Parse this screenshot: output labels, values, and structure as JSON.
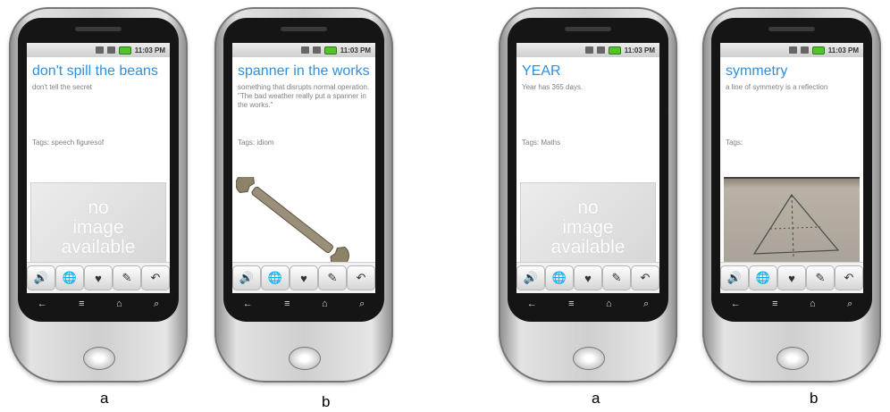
{
  "status_time": "11:03 PM",
  "phones": [
    {
      "title": "don't spill the beans",
      "description": "don't tell the secret",
      "tags": "Tags: speech figuresof",
      "image": "no-image",
      "noimage_text": [
        "no",
        "image",
        "available"
      ]
    },
    {
      "title": "spanner in the works",
      "description": "something that disrupts normal operation. \"The bad weather really put a spanner in the works.\"",
      "tags": "Tags: idiom",
      "image": "wrench-photo"
    },
    {
      "title": "YEAR",
      "description": "Year has 365 days.",
      "tags": "Tags: Maths",
      "image": "no-image",
      "noimage_text": [
        "no",
        "image",
        "available"
      ]
    },
    {
      "title": "symmetry",
      "description": "a line of symmetry is a reflection",
      "tags": "Tags:",
      "image": "triangle-sketch-photo"
    }
  ],
  "toolbar_icons": [
    "speaker-icon",
    "globe-icon",
    "heart-plus-icon",
    "pencil-icon",
    "reply-arrow-icon"
  ],
  "nav_icons": [
    "back-icon",
    "menu-icon",
    "home-icon",
    "search-icon"
  ],
  "captions": [
    "a",
    "b",
    "a",
    "b"
  ],
  "colors": {
    "title": "#2e8fe3",
    "body_text": "#808080",
    "battery": "#55c32a"
  }
}
